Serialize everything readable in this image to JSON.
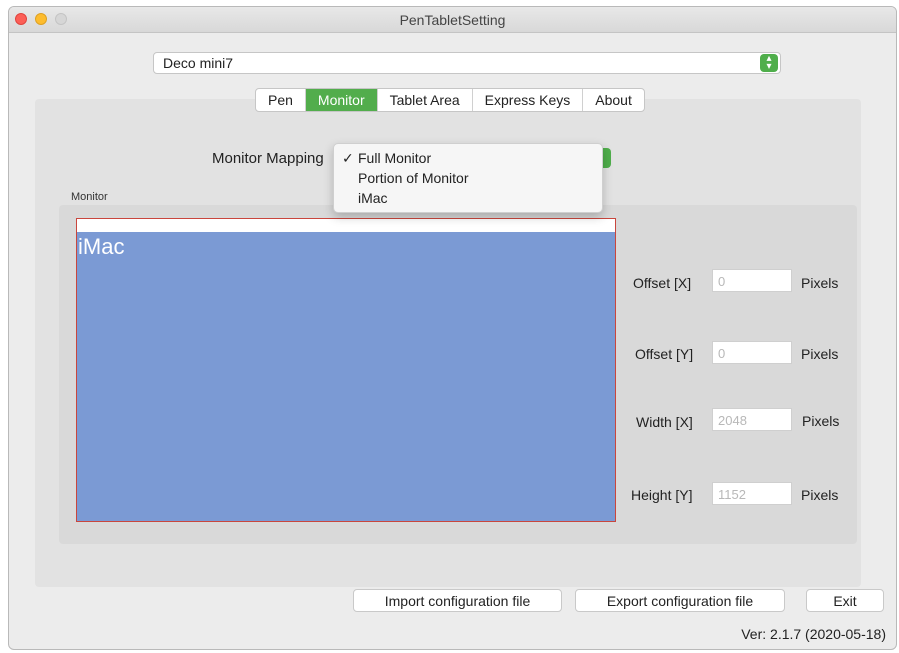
{
  "window": {
    "title": "PenTabletSetting"
  },
  "device": {
    "selected": "Deco mini7"
  },
  "tabs": [
    {
      "label": "Pen"
    },
    {
      "label": "Monitor"
    },
    {
      "label": "Tablet Area"
    },
    {
      "label": "Express Keys"
    },
    {
      "label": "About"
    }
  ],
  "active_tab": "Monitor",
  "mapping": {
    "label": "Monitor Mapping",
    "options": [
      "Full Monitor",
      "Portion of Monitor",
      "iMac"
    ],
    "selected": "Full Monitor",
    "check": "✓"
  },
  "monitor_group": {
    "label": "Monitor",
    "monitor_name": "iMac"
  },
  "fields": {
    "offset_x": {
      "label": "Offset [X]",
      "value": "0",
      "unit": "Pixels"
    },
    "offset_y": {
      "label": "Offset [Y]",
      "value": "0",
      "unit": "Pixels"
    },
    "width": {
      "label": "Width [X]",
      "value": "2048",
      "unit": "Pixels"
    },
    "height": {
      "label": "Height [Y]",
      "value": "1152",
      "unit": "Pixels"
    }
  },
  "buttons": {
    "import": "Import configuration file",
    "export": "Export configuration file",
    "exit": "Exit"
  },
  "version": "Ver: 2.1.7 (2020-05-18)",
  "colors": {
    "accent_green": "#52ad4c",
    "monitor_fill": "#7b9ad4",
    "monitor_border": "#c9463d"
  }
}
